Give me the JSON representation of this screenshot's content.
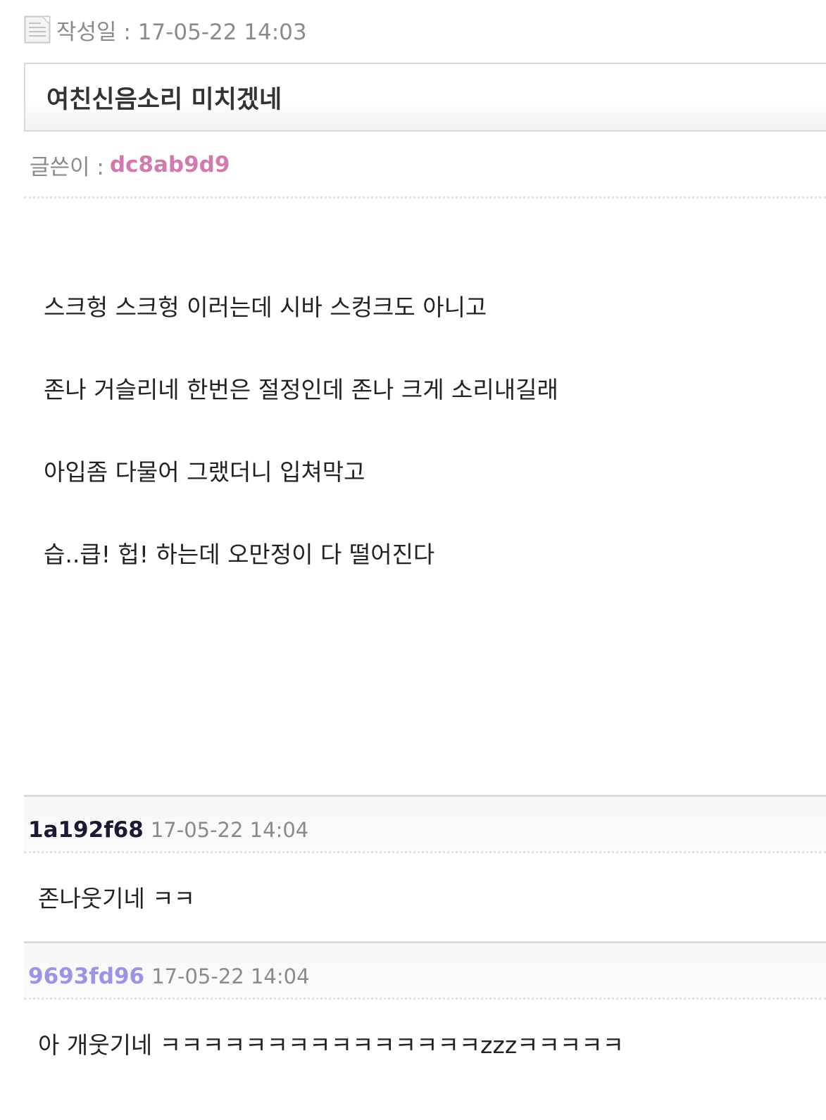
{
  "post": {
    "date_label": "작성일 : 17-05-22 14:03",
    "title": "여친신음소리 미치겠네",
    "author_label": "글쓴이 :",
    "author_name": "dc8ab9d9",
    "author_color": "#d27ab0",
    "body_lines": [
      "스크헝 스크헝 이러는데 시바 스컹크도 아니고",
      "존나 거슬리네 한번은 절정인데 존나 크게 소리내길래",
      "아입좀 다물어 그랬더니 입쳐막고",
      "습..큽! 헙! 하는데 오만정이 다 떨어진다"
    ]
  },
  "comments": [
    {
      "author": "1a192f68",
      "author_color": "#1c1a33",
      "time": "17-05-22 14:04",
      "text": "존나웃기네 ㅋㅋ"
    },
    {
      "author": "9693fd96",
      "author_color": "#9b94e6",
      "time": "17-05-22 14:04",
      "text": "아 개웃기네 ㅋㅋㅋㅋㅋㅋㅋㅋㅋㅋㅋㅋㅋㅋㅋzzzㅋㅋㅋㅋㅋ"
    }
  ],
  "icons": {
    "date_icon": "document-icon"
  }
}
